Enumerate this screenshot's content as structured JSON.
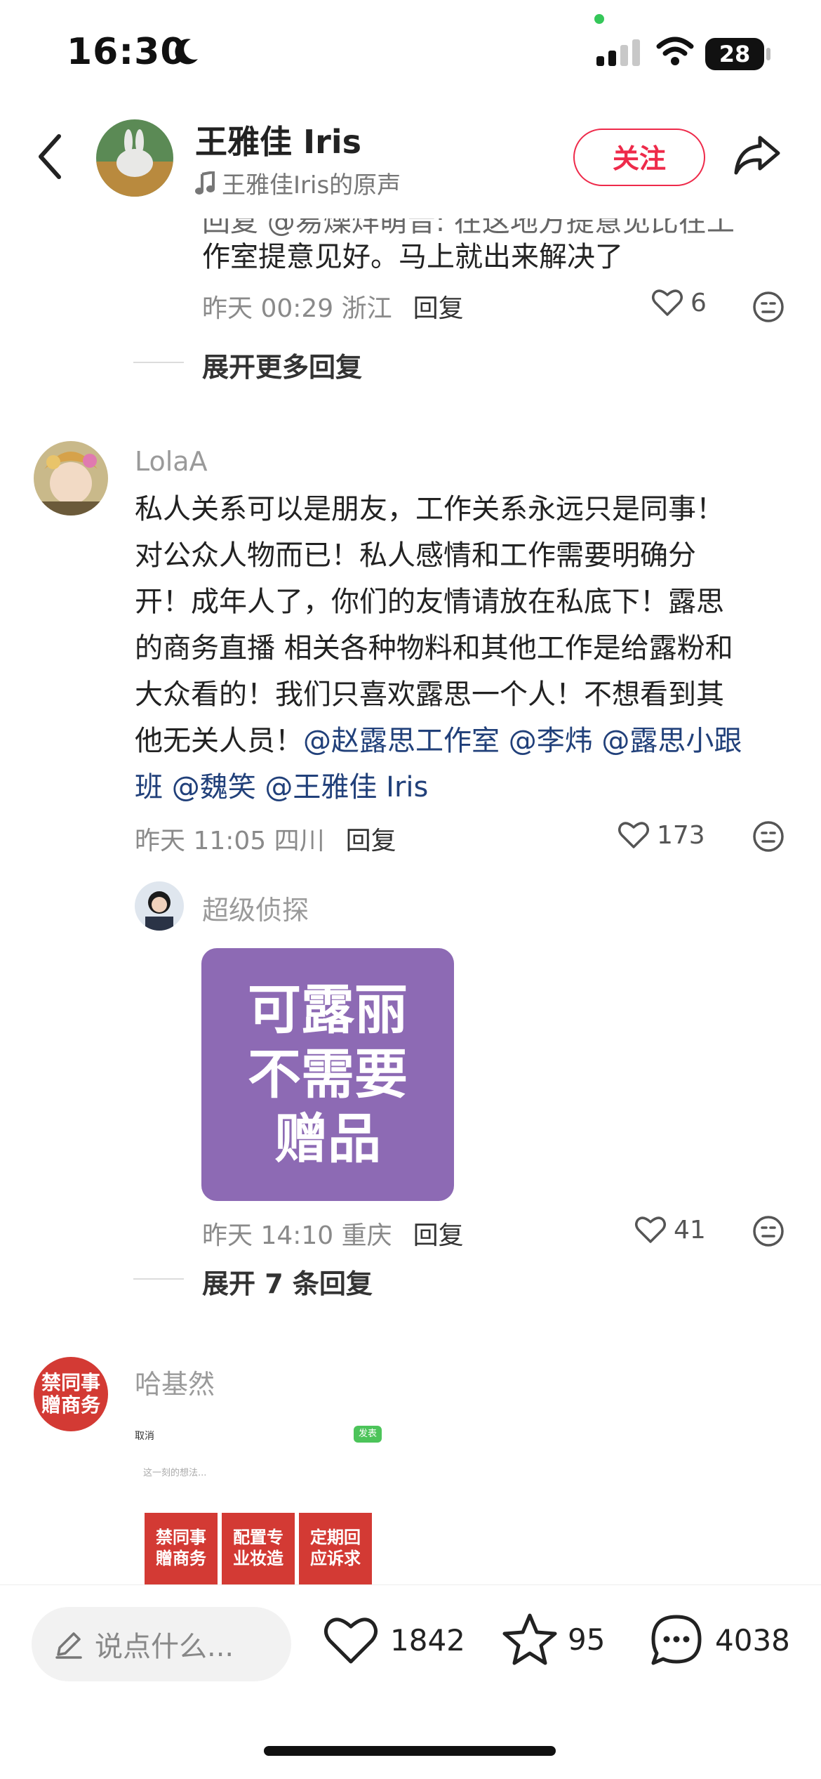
{
  "status": {
    "time": "16:30",
    "battery": "28"
  },
  "header": {
    "name": "王雅佳 Iris",
    "sound": "王雅佳Iris的原声",
    "follow_label": "关注"
  },
  "reply_prev": {
    "partial_line": "回复 @易燥烊萌音: 在这地方提意见比在工",
    "line2": "作室提意见好。马上就出来解决了",
    "time": "昨天 00:29 浙江",
    "reply_label": "回复",
    "likes": "6"
  },
  "expand_more": "展开更多回复",
  "comment1": {
    "user": "LolaA",
    "text_lines": [
      "私人关系可以是朋友，工作关系永远只是同事！",
      "对公众人物而已！私人感情和工作需要明确分",
      "开！成年人了，你们的友情请放在私底下！露思",
      "的商务直播 相关各种物料和其他工作是给露粉和",
      "大众看的！我们只喜欢露思一个人！不想看到其"
    ],
    "line6_text": "他无关人员！",
    "line6_mentions": "@赵露思工作室 @李炜 @露思小跟",
    "line7_mentions": "班 @魏笑 @王雅佳 Iris",
    "time": "昨天 11:05 四川",
    "reply_label": "回复",
    "likes": "173"
  },
  "reply1": {
    "user": "超级侦探",
    "image_lines": [
      "可露丽",
      "不需要",
      "赠品"
    ],
    "time": "昨天 14:10 重庆",
    "reply_label": "回复",
    "likes": "41"
  },
  "expand_replies": "展开 7 条回复",
  "comment2": {
    "user": "哈基然",
    "avatar_text": [
      "禁同事",
      "贈商务"
    ],
    "shot_cancel": "取消",
    "shot_post": "发表",
    "shot_placeholder": "这一刻的想法...",
    "tiles": [
      [
        "禁同事",
        "贈商务"
      ],
      [
        "配置专",
        "业妆造"
      ],
      [
        "定期回",
        "应诉求"
      ]
    ]
  },
  "bottom": {
    "input_placeholder": "说点什么...",
    "likes": "1842",
    "stars": "95",
    "comments": "4038"
  },
  "colors": {
    "accent": "#ee2a4a",
    "mention": "#21407a",
    "card": "#8d6ab4",
    "tile": "#d33a34"
  }
}
